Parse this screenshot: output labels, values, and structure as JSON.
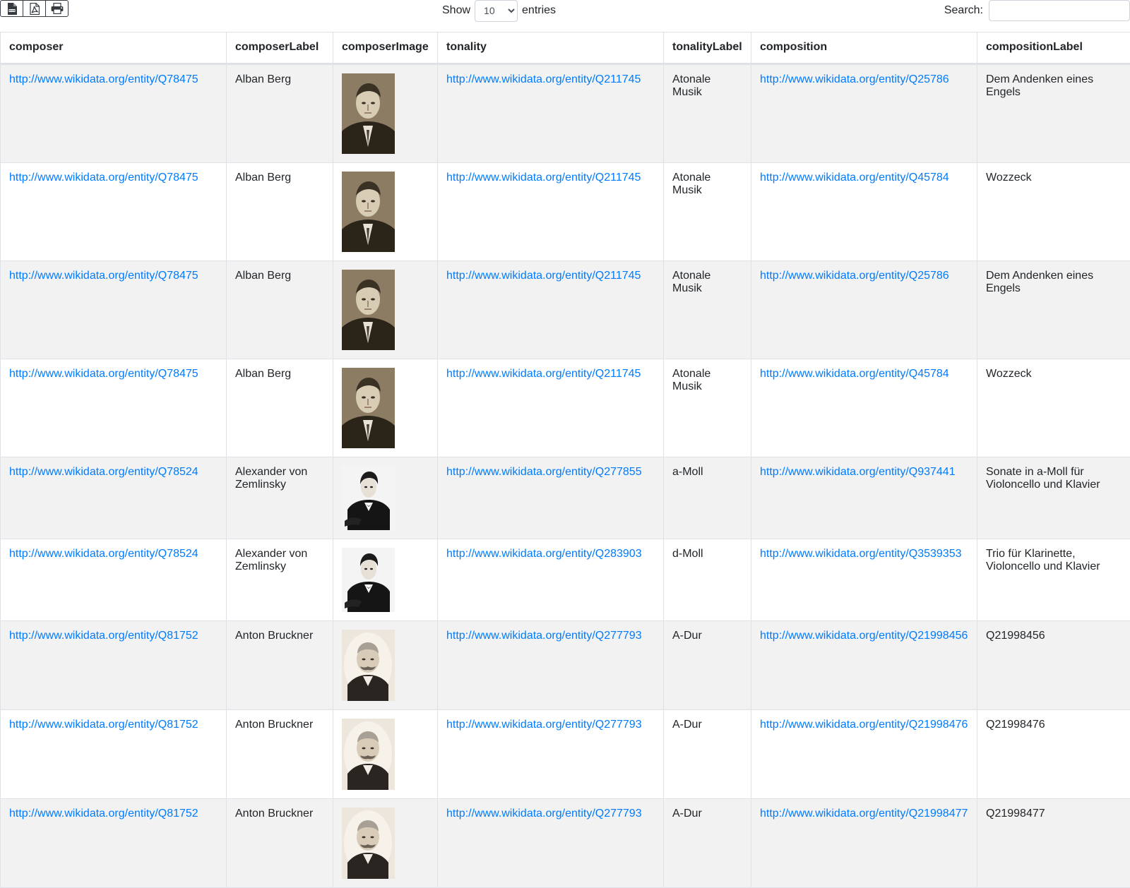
{
  "controls": {
    "show_label": "Show",
    "length_value": "10",
    "entries_label": "entries",
    "search_label": "Search:",
    "search_value": ""
  },
  "columns": [
    "composer",
    "composerLabel",
    "composerImage",
    "tonality",
    "tonalityLabel",
    "composition",
    "compositionLabel"
  ],
  "rows": [
    {
      "composer": "http://www.wikidata.org/entity/Q78475",
      "composerLabel": "Alban Berg",
      "image": "portrait-berg",
      "tonality": "http://www.wikidata.org/entity/Q211745",
      "tonalityLabel": "Atonale Musik",
      "composition": "http://www.wikidata.org/entity/Q25786",
      "compositionLabel": "Dem Andenken eines Engels"
    },
    {
      "composer": "http://www.wikidata.org/entity/Q78475",
      "composerLabel": "Alban Berg",
      "image": "portrait-berg",
      "tonality": "http://www.wikidata.org/entity/Q211745",
      "tonalityLabel": "Atonale Musik",
      "composition": "http://www.wikidata.org/entity/Q45784",
      "compositionLabel": "Wozzeck"
    },
    {
      "composer": "http://www.wikidata.org/entity/Q78475",
      "composerLabel": "Alban Berg",
      "image": "portrait-berg",
      "tonality": "http://www.wikidata.org/entity/Q211745",
      "tonalityLabel": "Atonale Musik",
      "composition": "http://www.wikidata.org/entity/Q25786",
      "compositionLabel": "Dem Andenken eines Engels"
    },
    {
      "composer": "http://www.wikidata.org/entity/Q78475",
      "composerLabel": "Alban Berg",
      "image": "portrait-berg",
      "tonality": "http://www.wikidata.org/entity/Q211745",
      "tonalityLabel": "Atonale Musik",
      "composition": "http://www.wikidata.org/entity/Q45784",
      "compositionLabel": "Wozzeck"
    },
    {
      "composer": "http://www.wikidata.org/entity/Q78524",
      "composerLabel": "Alexander von Zemlinsky",
      "image": "portrait-zemlinsky",
      "tonality": "http://www.wikidata.org/entity/Q277855",
      "tonalityLabel": "a-Moll",
      "composition": "http://www.wikidata.org/entity/Q937441",
      "compositionLabel": "Sonate in a-Moll für Violoncello und Klavier"
    },
    {
      "composer": "http://www.wikidata.org/entity/Q78524",
      "composerLabel": "Alexander von Zemlinsky",
      "image": "portrait-zemlinsky",
      "tonality": "http://www.wikidata.org/entity/Q283903",
      "tonalityLabel": "d-Moll",
      "composition": "http://www.wikidata.org/entity/Q3539353",
      "compositionLabel": "Trio für Klarinette, Violoncello und Klavier"
    },
    {
      "composer": "http://www.wikidata.org/entity/Q81752",
      "composerLabel": "Anton Bruckner",
      "image": "portrait-bruckner",
      "tonality": "http://www.wikidata.org/entity/Q277793",
      "tonalityLabel": "A-Dur",
      "composition": "http://www.wikidata.org/entity/Q21998456",
      "compositionLabel": "Q21998456"
    },
    {
      "composer": "http://www.wikidata.org/entity/Q81752",
      "composerLabel": "Anton Bruckner",
      "image": "portrait-bruckner",
      "tonality": "http://www.wikidata.org/entity/Q277793",
      "tonalityLabel": "A-Dur",
      "composition": "http://www.wikidata.org/entity/Q21998476",
      "compositionLabel": "Q21998476"
    },
    {
      "composer": "http://www.wikidata.org/entity/Q81752",
      "composerLabel": "Anton Bruckner",
      "image": "portrait-bruckner",
      "tonality": "http://www.wikidata.org/entity/Q277793",
      "tonalityLabel": "A-Dur",
      "composition": "http://www.wikidata.org/entity/Q21998477",
      "compositionLabel": "Q21998477"
    }
  ]
}
